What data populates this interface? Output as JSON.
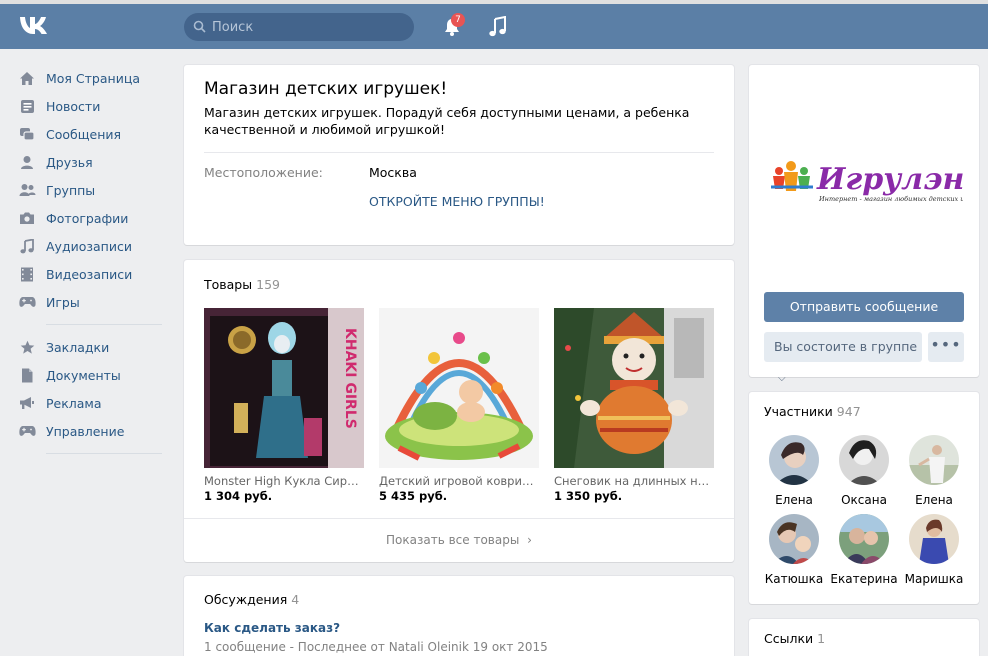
{
  "header": {
    "search_placeholder": "Поиск",
    "notifications_count": "7",
    "accent": "#5b7fa6"
  },
  "sidebar": {
    "items": [
      {
        "label": "Моя Страница",
        "icon": "home-icon"
      },
      {
        "label": "Новости",
        "icon": "news-icon"
      },
      {
        "label": "Сообщения",
        "icon": "messages-icon"
      },
      {
        "label": "Друзья",
        "icon": "friends-icon"
      },
      {
        "label": "Группы",
        "icon": "groups-icon"
      },
      {
        "label": "Фотографии",
        "icon": "camera-icon"
      },
      {
        "label": "Аудиозаписи",
        "icon": "music-icon"
      },
      {
        "label": "Видеозаписи",
        "icon": "film-icon"
      },
      {
        "label": "Игры",
        "icon": "gamepad-icon"
      }
    ],
    "extra_items": [
      {
        "label": "Закладки",
        "icon": "star-icon"
      },
      {
        "label": "Документы",
        "icon": "document-icon"
      },
      {
        "label": "Реклама",
        "icon": "megaphone-icon"
      },
      {
        "label": "Управление",
        "icon": "gamepad-icon"
      }
    ]
  },
  "group": {
    "name": "Магазин детских игрушек!",
    "description": "Магазин детских игрушек. Порадуй себя доступными ценами, а ребенка качественной и любимой игрушкой!",
    "location_label": "Местоположение:",
    "location_value": "Москва",
    "menu_link": "ОТКРОЙТЕ МЕНЮ ГРУППЫ!"
  },
  "goods": {
    "title": "Товары",
    "count": "159",
    "items": [
      {
        "name": "Monster High Кукла Сирена",
        "price": "1 304 руб."
      },
      {
        "name": "Детский игровой коврик с дугами",
        "price": "5 435 руб."
      },
      {
        "name": "Снеговик на длинных ногах",
        "price": "1 350 руб."
      }
    ],
    "show_all": "Показать все товары"
  },
  "discussions": {
    "title": "Обсуждения",
    "count": "4",
    "topic": "Как сделать заказ?",
    "meta": "1 сообщение  -  Последнее от Natali Oleinik 19 окт 2015"
  },
  "side": {
    "logo_text": "Игрулэнд",
    "logo_tagline": "Интернет - магазин любимых детских игрушек",
    "send_message": "Отправить сообщение",
    "membership": "Вы состоите в группе",
    "more": "•••"
  },
  "members": {
    "title": "Участники",
    "count": "947",
    "list": [
      {
        "name": "Елена"
      },
      {
        "name": "Оксана"
      },
      {
        "name": "Елена"
      },
      {
        "name": "Катюшка"
      },
      {
        "name": "Екатерина"
      },
      {
        "name": "Маришка"
      }
    ]
  },
  "links": {
    "title": "Ссылки",
    "count": "1"
  }
}
